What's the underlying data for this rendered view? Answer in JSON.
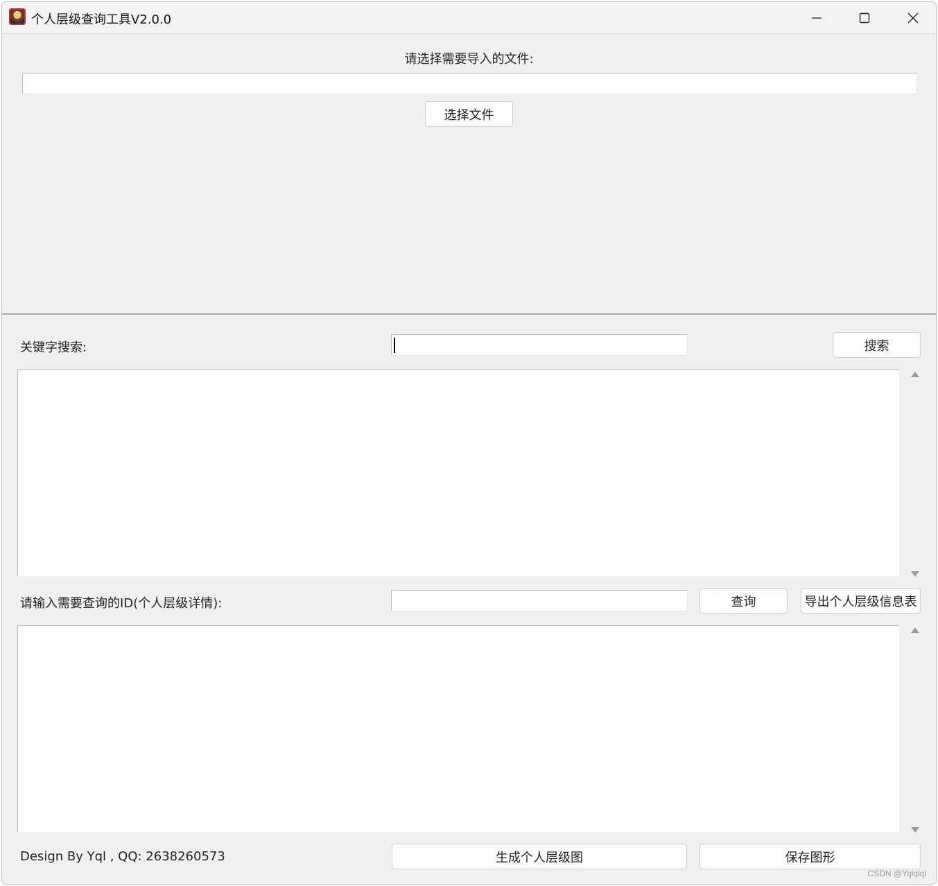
{
  "window": {
    "title": "个人层级查询工具V2.0.0",
    "icon": "app-avatar-icon"
  },
  "file_section": {
    "prompt": "请选择需要导入的文件:",
    "file_path_value": "",
    "select_button": "选择文件"
  },
  "search_section": {
    "label": "关键字搜索:",
    "keyword_value": "",
    "search_button": "搜索"
  },
  "query_section": {
    "label": "请输入需要查询的ID(个人层级详情):",
    "id_value": "",
    "query_button": "查询",
    "export_button": "导出个人层级信息表"
  },
  "footer": {
    "credit": "Design By Yql , QQ:   2638260573",
    "generate_button": "生成个人层级图",
    "save_button": "保存图形"
  },
  "watermark": "CSDN @Yqlqlql",
  "colors": {
    "window_bg": "#f0f0f0",
    "input_bg": "#ffffff",
    "button_bg": "#fdfdfd"
  }
}
